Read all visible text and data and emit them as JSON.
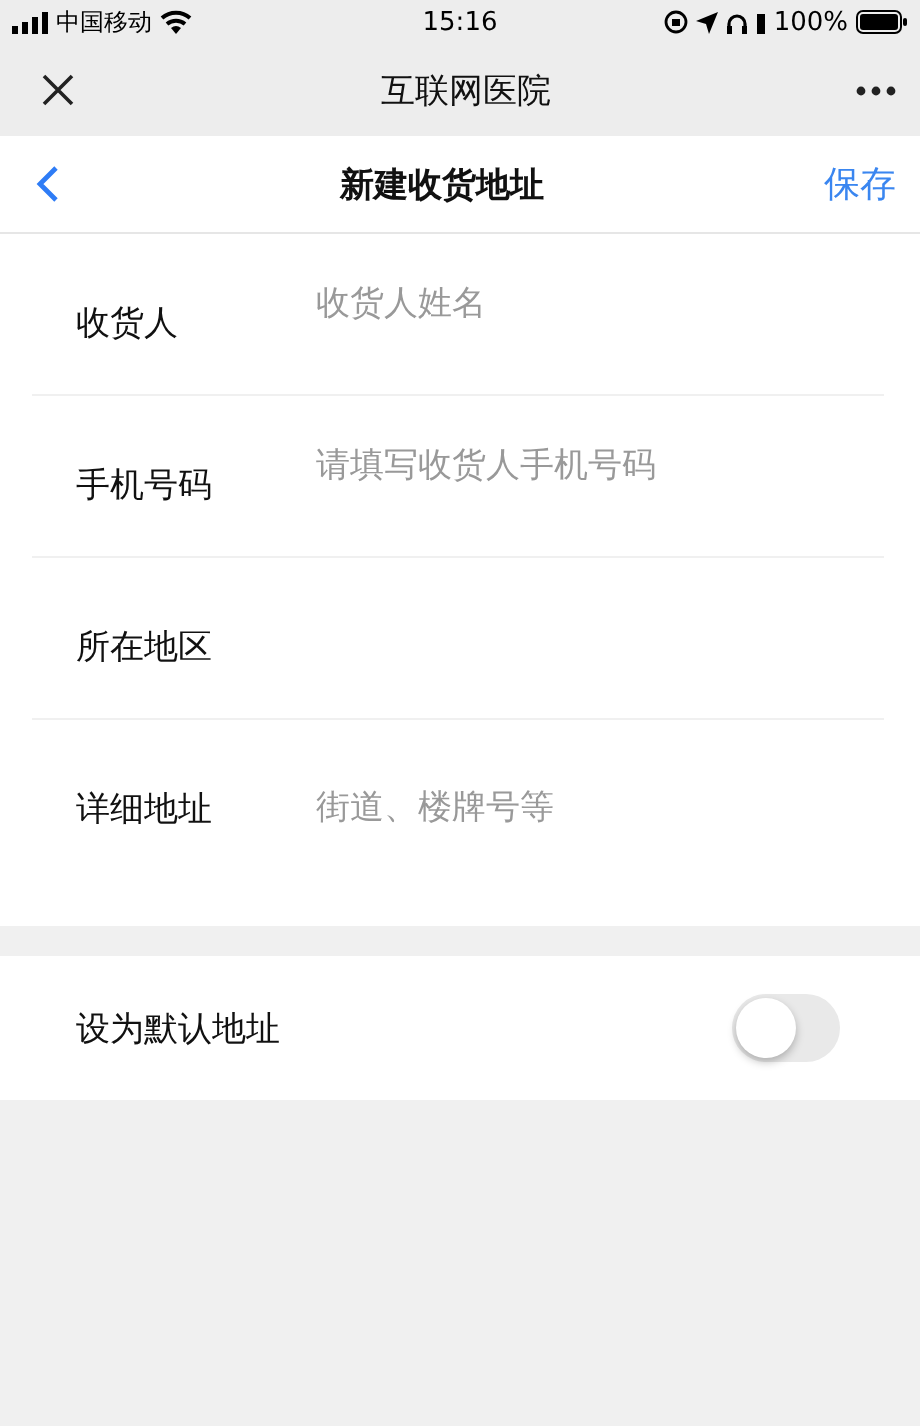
{
  "status_bar": {
    "carrier": "中国移动",
    "time": "15:16",
    "battery": "100%"
  },
  "app_bar": {
    "title": "互联网医院"
  },
  "header": {
    "title": "新建收货地址",
    "action": "保存"
  },
  "fields": [
    {
      "label": "收货人",
      "placeholder": "收货人姓名"
    },
    {
      "label": "手机号码",
      "placeholder": "请填写收货人手机号码"
    },
    {
      "label": "所在地区"
    },
    {
      "label": "详细地址",
      "placeholder": "街道、楼牌号等"
    }
  ],
  "default_toggle": {
    "label": "设为默认地址",
    "on": false
  }
}
